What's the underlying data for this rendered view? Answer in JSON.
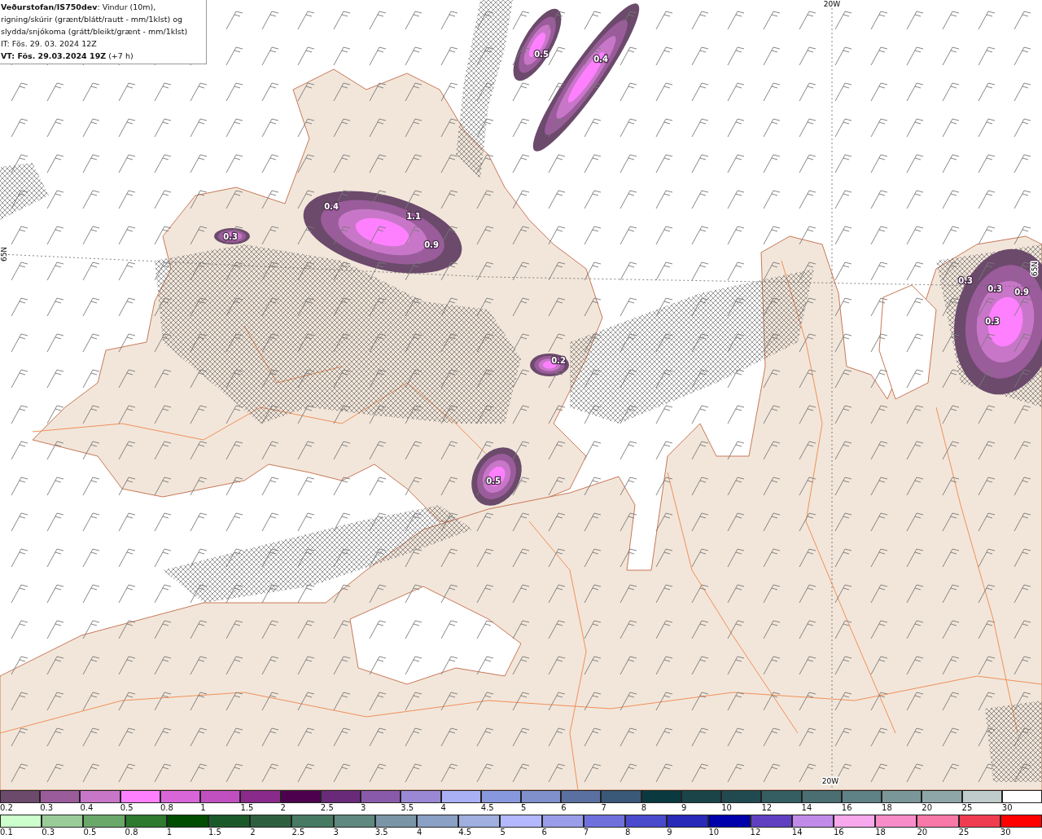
{
  "header": {
    "description": "**Veðurstofan/IS750dev**: Vindur (10m), rigning/skúrir (grænt/blátt/rautt - mm/1klst) og slydda/snjókoma (grátt/bleikt/grænt - mm/1klst)",
    "issue_time": "IT: Fös. 29. 03. 2024 12Z",
    "valid_time": "**VT: Fös. 29.03.2024 19Z** (+7 h)"
  },
  "map": {
    "grid_labels": [
      "20W",
      "20W",
      "65N",
      "65N"
    ],
    "contour_labels": [
      "0.5",
      "0.4",
      "0.4",
      "1.1",
      "0.9",
      "0.3",
      "0.2",
      "0.5",
      "0.3",
      "0.3",
      "0.9",
      "0.3"
    ]
  },
  "legends": [
    {
      "swatches": [
        {
          "label": "0.2",
          "color": "#6b4a6b"
        },
        {
          "label": "0.3",
          "color": "#9a5c9a"
        },
        {
          "label": "0.4",
          "color": "#c877c8"
        },
        {
          "label": "0.5",
          "color": "#ff80ff"
        },
        {
          "label": "0.8",
          "color": "#d966d9"
        },
        {
          "label": "1",
          "color": "#c050c0"
        },
        {
          "label": "1.5",
          "color": "#8a2a8a"
        },
        {
          "label": "2",
          "color": "#4d004d"
        },
        {
          "label": "2.5",
          "color": "#6a2a7a"
        },
        {
          "label": "3",
          "color": "#8a5aaa"
        },
        {
          "label": "3.5",
          "color": "#9a88d4"
        },
        {
          "label": "4",
          "color": "#aab0f4"
        },
        {
          "label": "4.5",
          "color": "#8898dd"
        },
        {
          "label": "5",
          "color": "#8090cc"
        },
        {
          "label": "6",
          "color": "#5a70a0"
        },
        {
          "label": "7",
          "color": "#3a5878"
        },
        {
          "label": "8",
          "color": "#0a3a40"
        },
        {
          "label": "9",
          "color": "#1a4448"
        },
        {
          "label": "10",
          "color": "#204a50"
        },
        {
          "label": "12",
          "color": "#355e62"
        },
        {
          "label": "14",
          "color": "#4a6e72"
        },
        {
          "label": "16",
          "color": "#5e8286"
        },
        {
          "label": "18",
          "color": "#7a9698"
        },
        {
          "label": "20",
          "color": "#8fa6a8"
        },
        {
          "label": "25",
          "color": "#c0cccc"
        },
        {
          "label": "30",
          "color": "#ffffff"
        }
      ]
    },
    {
      "swatches": [
        {
          "label": "0.1",
          "color": "#ccffcc"
        },
        {
          "label": "0.3",
          "color": "#99cc99"
        },
        {
          "label": "0.5",
          "color": "#6aa86a"
        },
        {
          "label": "0.8",
          "color": "#2e7a2e"
        },
        {
          "label": "1",
          "color": "#004d00"
        },
        {
          "label": "1.5",
          "color": "#1a5a2a"
        },
        {
          "label": "2",
          "color": "#2e6040"
        },
        {
          "label": "2.5",
          "color": "#467a62"
        },
        {
          "label": "3",
          "color": "#5e8880"
        },
        {
          "label": "3.5",
          "color": "#7a96a6"
        },
        {
          "label": "4",
          "color": "#8aa0c4"
        },
        {
          "label": "4.5",
          "color": "#a0aee0"
        },
        {
          "label": "5",
          "color": "#b4b8ff"
        },
        {
          "label": "6",
          "color": "#9a9ee8"
        },
        {
          "label": "7",
          "color": "#7070dd"
        },
        {
          "label": "8",
          "color": "#4a4acc"
        },
        {
          "label": "9",
          "color": "#2a2ab8"
        },
        {
          "label": "10",
          "color": "#0000aa"
        },
        {
          "label": "12",
          "color": "#6040c0"
        },
        {
          "label": "14",
          "color": "#c08ce8"
        },
        {
          "label": "16",
          "color": "#f8a8ec"
        },
        {
          "label": "18",
          "color": "#f88cc8"
        },
        {
          "label": "20",
          "color": "#f878a8"
        },
        {
          "label": "25",
          "color": "#f03c50"
        },
        {
          "label": "30",
          "color": "#ff0000"
        }
      ]
    }
  ]
}
